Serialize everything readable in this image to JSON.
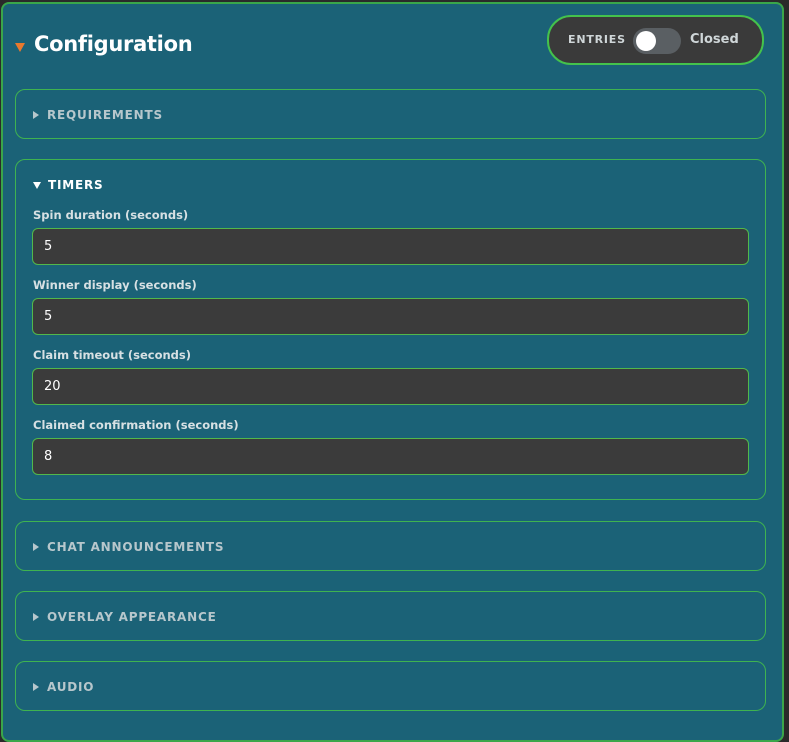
{
  "header": {
    "title": "Configuration"
  },
  "entries": {
    "label": "ENTRIES",
    "state": "Closed"
  },
  "sections": {
    "requirements": {
      "label": "REQUIREMENTS"
    },
    "timers": {
      "label": "TIMERS",
      "fields": [
        {
          "label": "Spin duration (seconds)",
          "value": "5"
        },
        {
          "label": "Winner display (seconds)",
          "value": "5"
        },
        {
          "label": "Claim timeout (seconds)",
          "value": "20"
        },
        {
          "label": "Claimed confirmation (seconds)",
          "value": "8"
        }
      ]
    },
    "chat": {
      "label": "CHAT ANNOUNCEMENTS"
    },
    "overlay": {
      "label": "OVERLAY APPEARANCE"
    },
    "audio": {
      "label": "AUDIO"
    }
  }
}
